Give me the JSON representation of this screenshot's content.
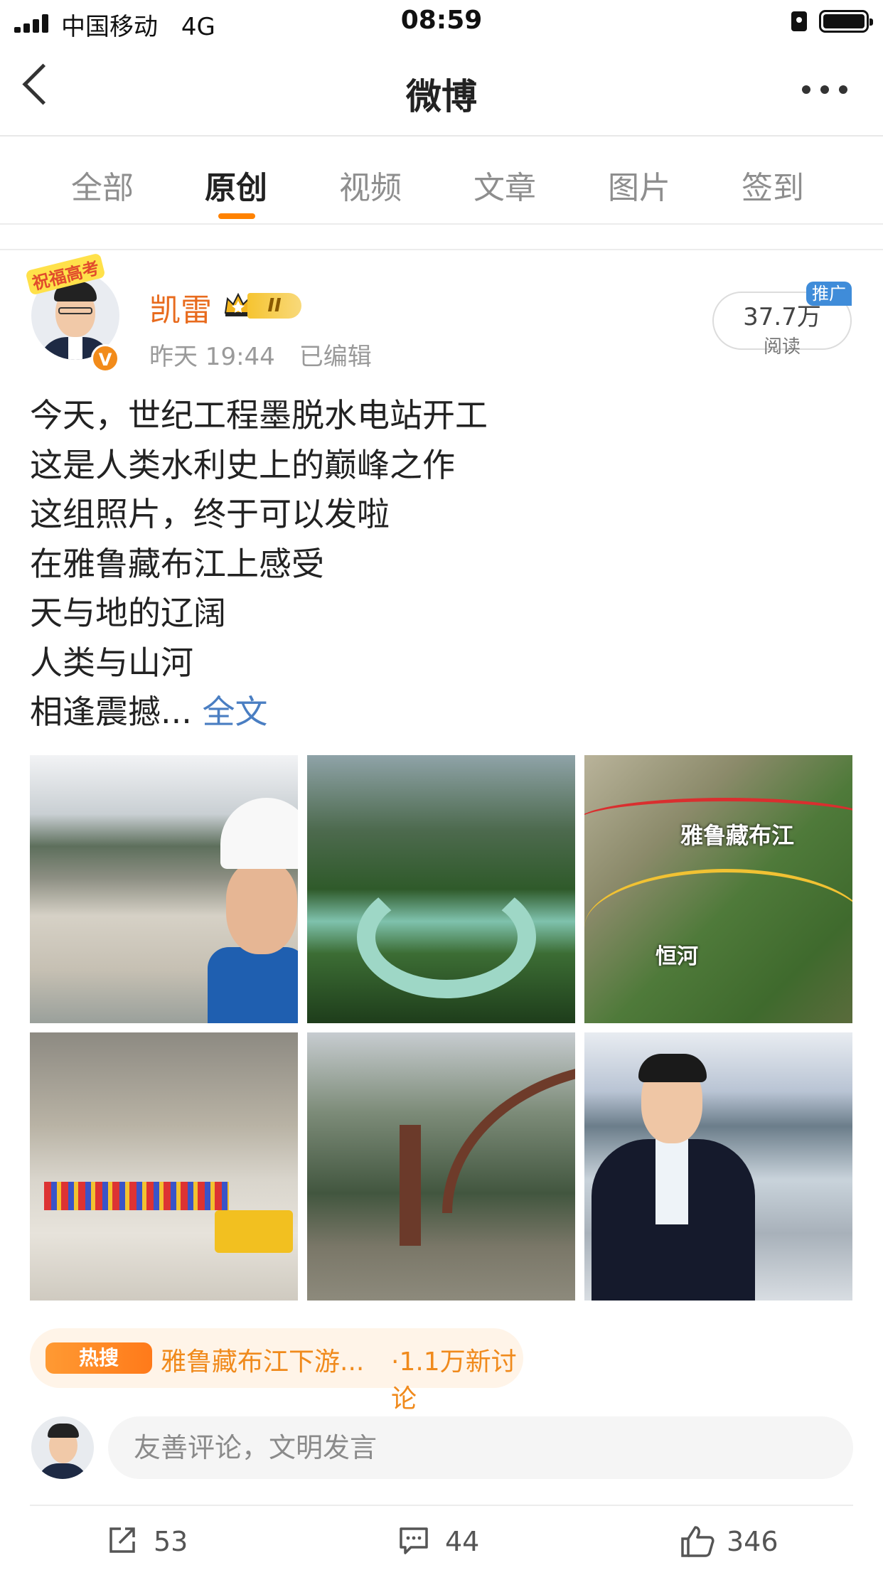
{
  "status_bar": {
    "carrier": "中国移动",
    "network": "4G",
    "time": "08:59"
  },
  "nav": {
    "title": "微博"
  },
  "tabs": [
    {
      "label": "全部"
    },
    {
      "label": "原创",
      "active": true
    },
    {
      "label": "视频"
    },
    {
      "label": "文章"
    },
    {
      "label": "图片"
    },
    {
      "label": "签到"
    }
  ],
  "post": {
    "avatar_badge": "祝福高考",
    "username": "凯雷",
    "level_badge": "II",
    "time": "昨天 19:44",
    "edited": "已编辑",
    "read_count": "37.7万",
    "read_label": "阅读",
    "promo_label": "推广",
    "lines": [
      "今天，世纪工程墨脱水电站开工",
      "这是人类水利史上的巅峰之作",
      "这组照片，终于可以发啦",
      "在雅鲁藏布江上感受",
      "天与地的辽阔",
      "人类与山河",
      "相逢震撼..."
    ],
    "more_label": "全文",
    "photos": [
      {
        "alt": "selfie-helmet"
      },
      {
        "alt": "river-canyon"
      },
      {
        "alt": "map",
        "labels": [
          "雅鲁藏布江",
          "恒河"
        ]
      },
      {
        "alt": "construction-site-ceremony"
      },
      {
        "alt": "bridge-construction"
      },
      {
        "alt": "portrait-riverside"
      }
    ]
  },
  "hot_topic": {
    "icon_label": "热搜",
    "text": "雅鲁藏布江下游...",
    "count": "·1.1万新讨论"
  },
  "comment": {
    "placeholder": "友善评论，文明发言"
  },
  "actions": {
    "share_count": "53",
    "comment_count": "44",
    "like_count": "346"
  },
  "colors": {
    "accent_orange": "#ff8200",
    "username": "#e86b1e",
    "link_blue": "#4a7ec2",
    "promo_blue": "#3f8cd9"
  }
}
